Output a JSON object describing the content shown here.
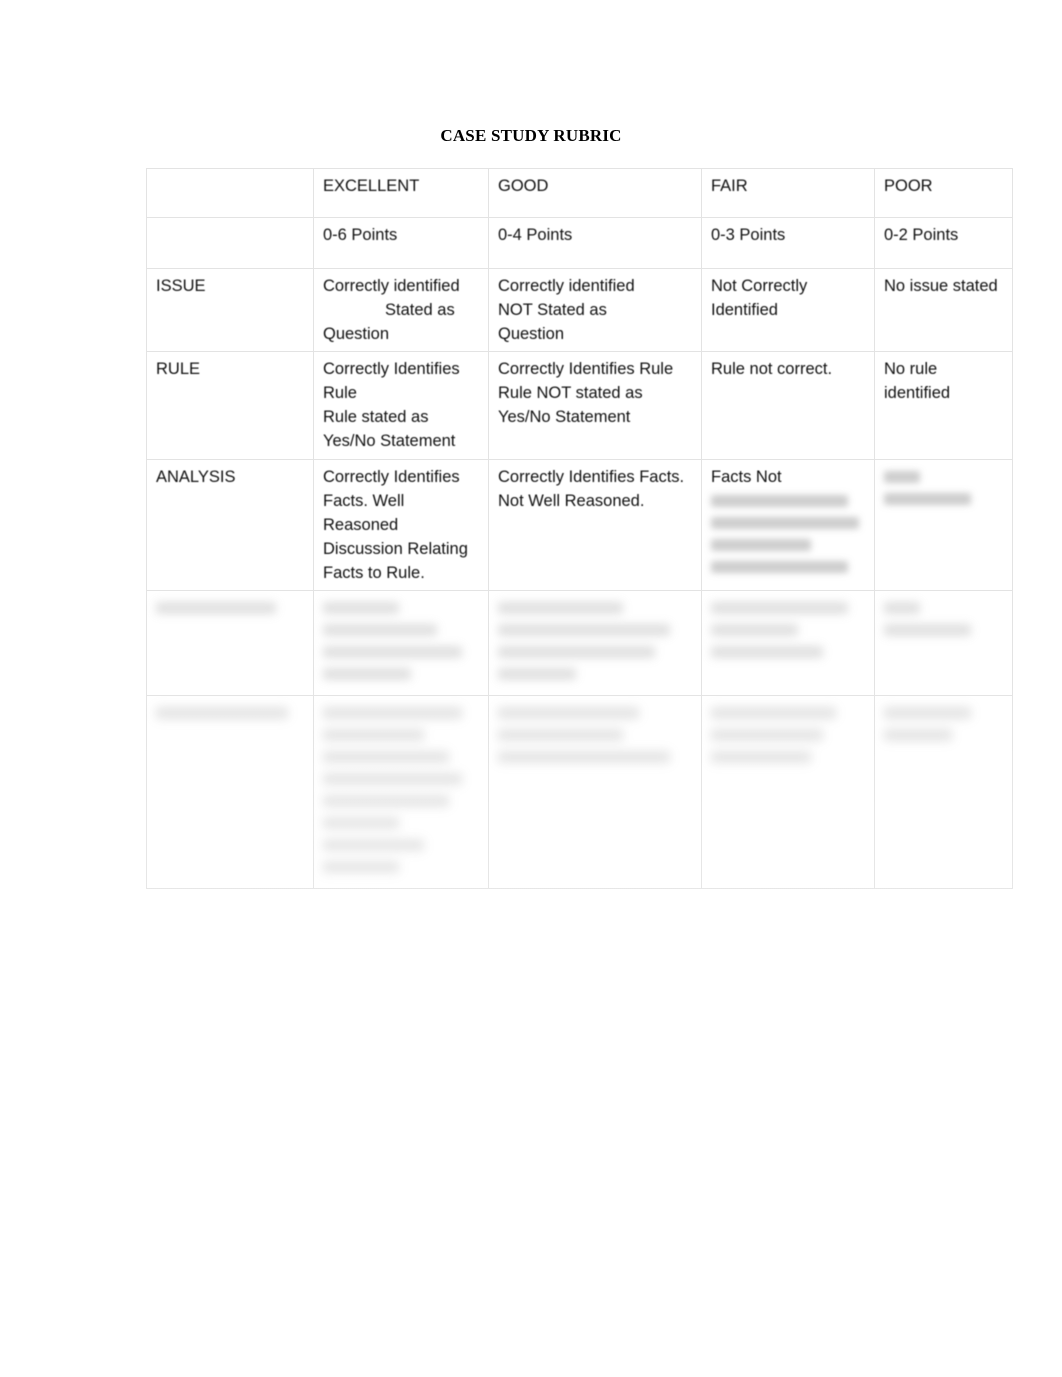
{
  "document": {
    "title": "CASE STUDY RUBRIC",
    "page_background": "#ffffff",
    "text_color": "#000000",
    "border_color": "#e3e3e3"
  },
  "table": {
    "column_headers": [
      {
        "label": "",
        "points": ""
      },
      {
        "label": "EXCELLENT",
        "points": "0-6 Points"
      },
      {
        "label": "GOOD",
        "points": "0-4 Points"
      },
      {
        "label": "FAIR",
        "points": "0-3 Points"
      },
      {
        "label": "POOR",
        "points": "0-2 Points"
      }
    ],
    "rows": [
      {
        "criterion": "ISSUE",
        "legible": true,
        "cells": [
          {
            "lines": [
              "Correctly identified",
              "Stated as",
              "Question"
            ],
            "indent_line": 1,
            "legible": true
          },
          {
            "lines": [
              "Correctly identified",
              "NOT Stated as",
              "Question"
            ],
            "legible": true
          },
          {
            "lines": [
              "Not Correctly Identified"
            ],
            "legible": true
          },
          {
            "lines": [
              "No issue stated"
            ],
            "legible": true
          }
        ]
      },
      {
        "criterion": "RULE",
        "legible": true,
        "cells": [
          {
            "lines": [
              "Correctly Identifies Rule",
              "Rule stated as Yes/No Statement"
            ],
            "legible": true
          },
          {
            "lines": [
              "Correctly Identifies Rule",
              "Rule NOT stated as Yes/No Statement"
            ],
            "legible": true
          },
          {
            "lines": [
              "Rule not correct."
            ],
            "legible": true
          },
          {
            "lines": [
              "No rule identified"
            ],
            "legible": true
          }
        ]
      },
      {
        "criterion": "ANALYSIS",
        "legible": true,
        "cells": [
          {
            "lines": [
              "Correctly Identifies Facts. Well Reasoned Discussion Relating Facts to Rule."
            ],
            "legible": true
          },
          {
            "lines": [
              "Correctly Identifies Facts. Not Well Reasoned."
            ],
            "legible": true
          },
          {
            "lines": [
              "Facts Not"
            ],
            "legible": true,
            "illegible_trailing_lines": 4
          },
          {
            "lines": [],
            "legible": false,
            "illegible_lines": 2
          }
        ]
      },
      {
        "criterion": "",
        "legible": false,
        "criterion_illegible_lines": 1,
        "cells": [
          {
            "lines": [],
            "legible": false,
            "illegible_lines": 4
          },
          {
            "lines": [],
            "legible": false,
            "illegible_lines": 4
          },
          {
            "lines": [],
            "legible": false,
            "illegible_lines": 3
          },
          {
            "lines": [],
            "legible": false,
            "illegible_lines": 2
          }
        ]
      },
      {
        "criterion": "",
        "legible": false,
        "criterion_illegible_lines": 1,
        "cells": [
          {
            "lines": [],
            "legible": false,
            "illegible_lines": 8
          },
          {
            "lines": [],
            "legible": false,
            "illegible_lines": 3
          },
          {
            "lines": [],
            "legible": false,
            "illegible_lines": 3
          },
          {
            "lines": [],
            "legible": false,
            "illegible_lines": 2
          }
        ]
      }
    ]
  }
}
